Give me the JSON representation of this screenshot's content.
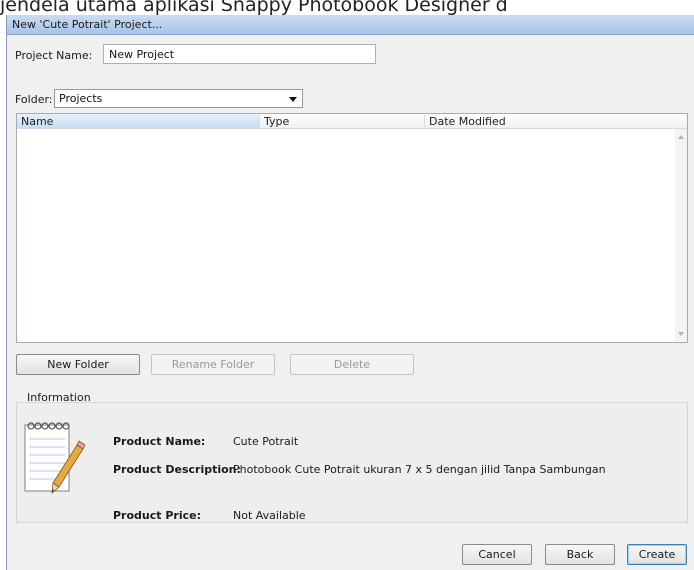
{
  "caption": "jendela utama aplikasi Snappy Photobook Designer d",
  "window": {
    "title": "New 'Cute Potrait' Project..."
  },
  "project": {
    "label": "Project Name:",
    "value": "New Project"
  },
  "folder": {
    "label": "Folder:",
    "selected": "Projects"
  },
  "file_list": {
    "columns": [
      "Name",
      "Type",
      "Date Modified"
    ],
    "rows": []
  },
  "folder_buttons": {
    "new": "New Folder",
    "rename": "Rename Folder",
    "delete": "Delete"
  },
  "info": {
    "title": "Information",
    "product_name_label": "Product Name:",
    "product_name": "Cute Potrait",
    "product_description_label": "Product Description:",
    "product_description": "Photobook Cute Potrait ukuran 7 x 5  dengan jilid Tanpa Sambungan",
    "product_price_label": "Product Price:",
    "product_price": "Not Available"
  },
  "dialog_buttons": {
    "cancel": "Cancel",
    "back": "Back",
    "create": "Create"
  },
  "icons": {
    "notepad": "notepad-pencil-icon",
    "dropdown": "chevron-down-icon"
  }
}
